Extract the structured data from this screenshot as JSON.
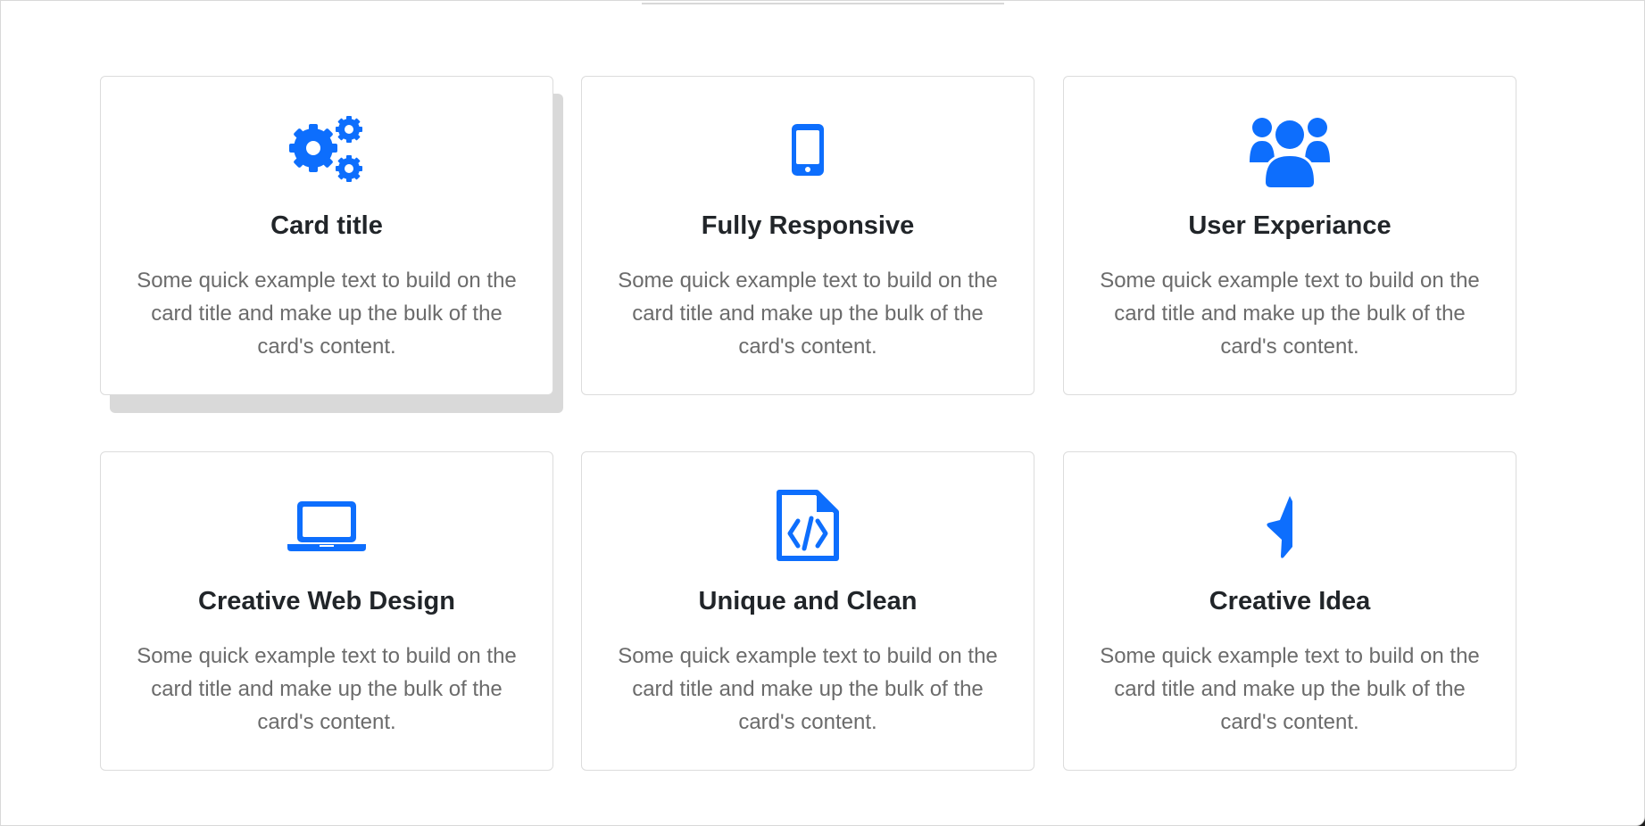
{
  "accent_color": "#0d6efd",
  "cards": [
    {
      "icon": "gears-icon",
      "title": "Card title",
      "text": "Some quick example text to build on the card title and make up the bulk of the card's content."
    },
    {
      "icon": "mobile-phone-icon",
      "title": "Fully Responsive",
      "text": "Some quick example text to build on the card title and make up the bulk of the card's content."
    },
    {
      "icon": "users-icon",
      "title": "User Experiance",
      "text": "Some quick example text to build on the card title and make up the bulk of the card's content."
    },
    {
      "icon": "laptop-icon",
      "title": "Creative Web Design",
      "text": "Some quick example text to build on the card title and make up the bulk of the card's content."
    },
    {
      "icon": "code-file-icon",
      "title": "Unique and Clean",
      "text": "Some quick example text to build on the card title and make up the bulk of the card's content."
    },
    {
      "icon": "half-star-icon",
      "title": "Creative Idea",
      "text": "Some quick example text to build on the card title and make up the bulk of the card's content."
    }
  ]
}
